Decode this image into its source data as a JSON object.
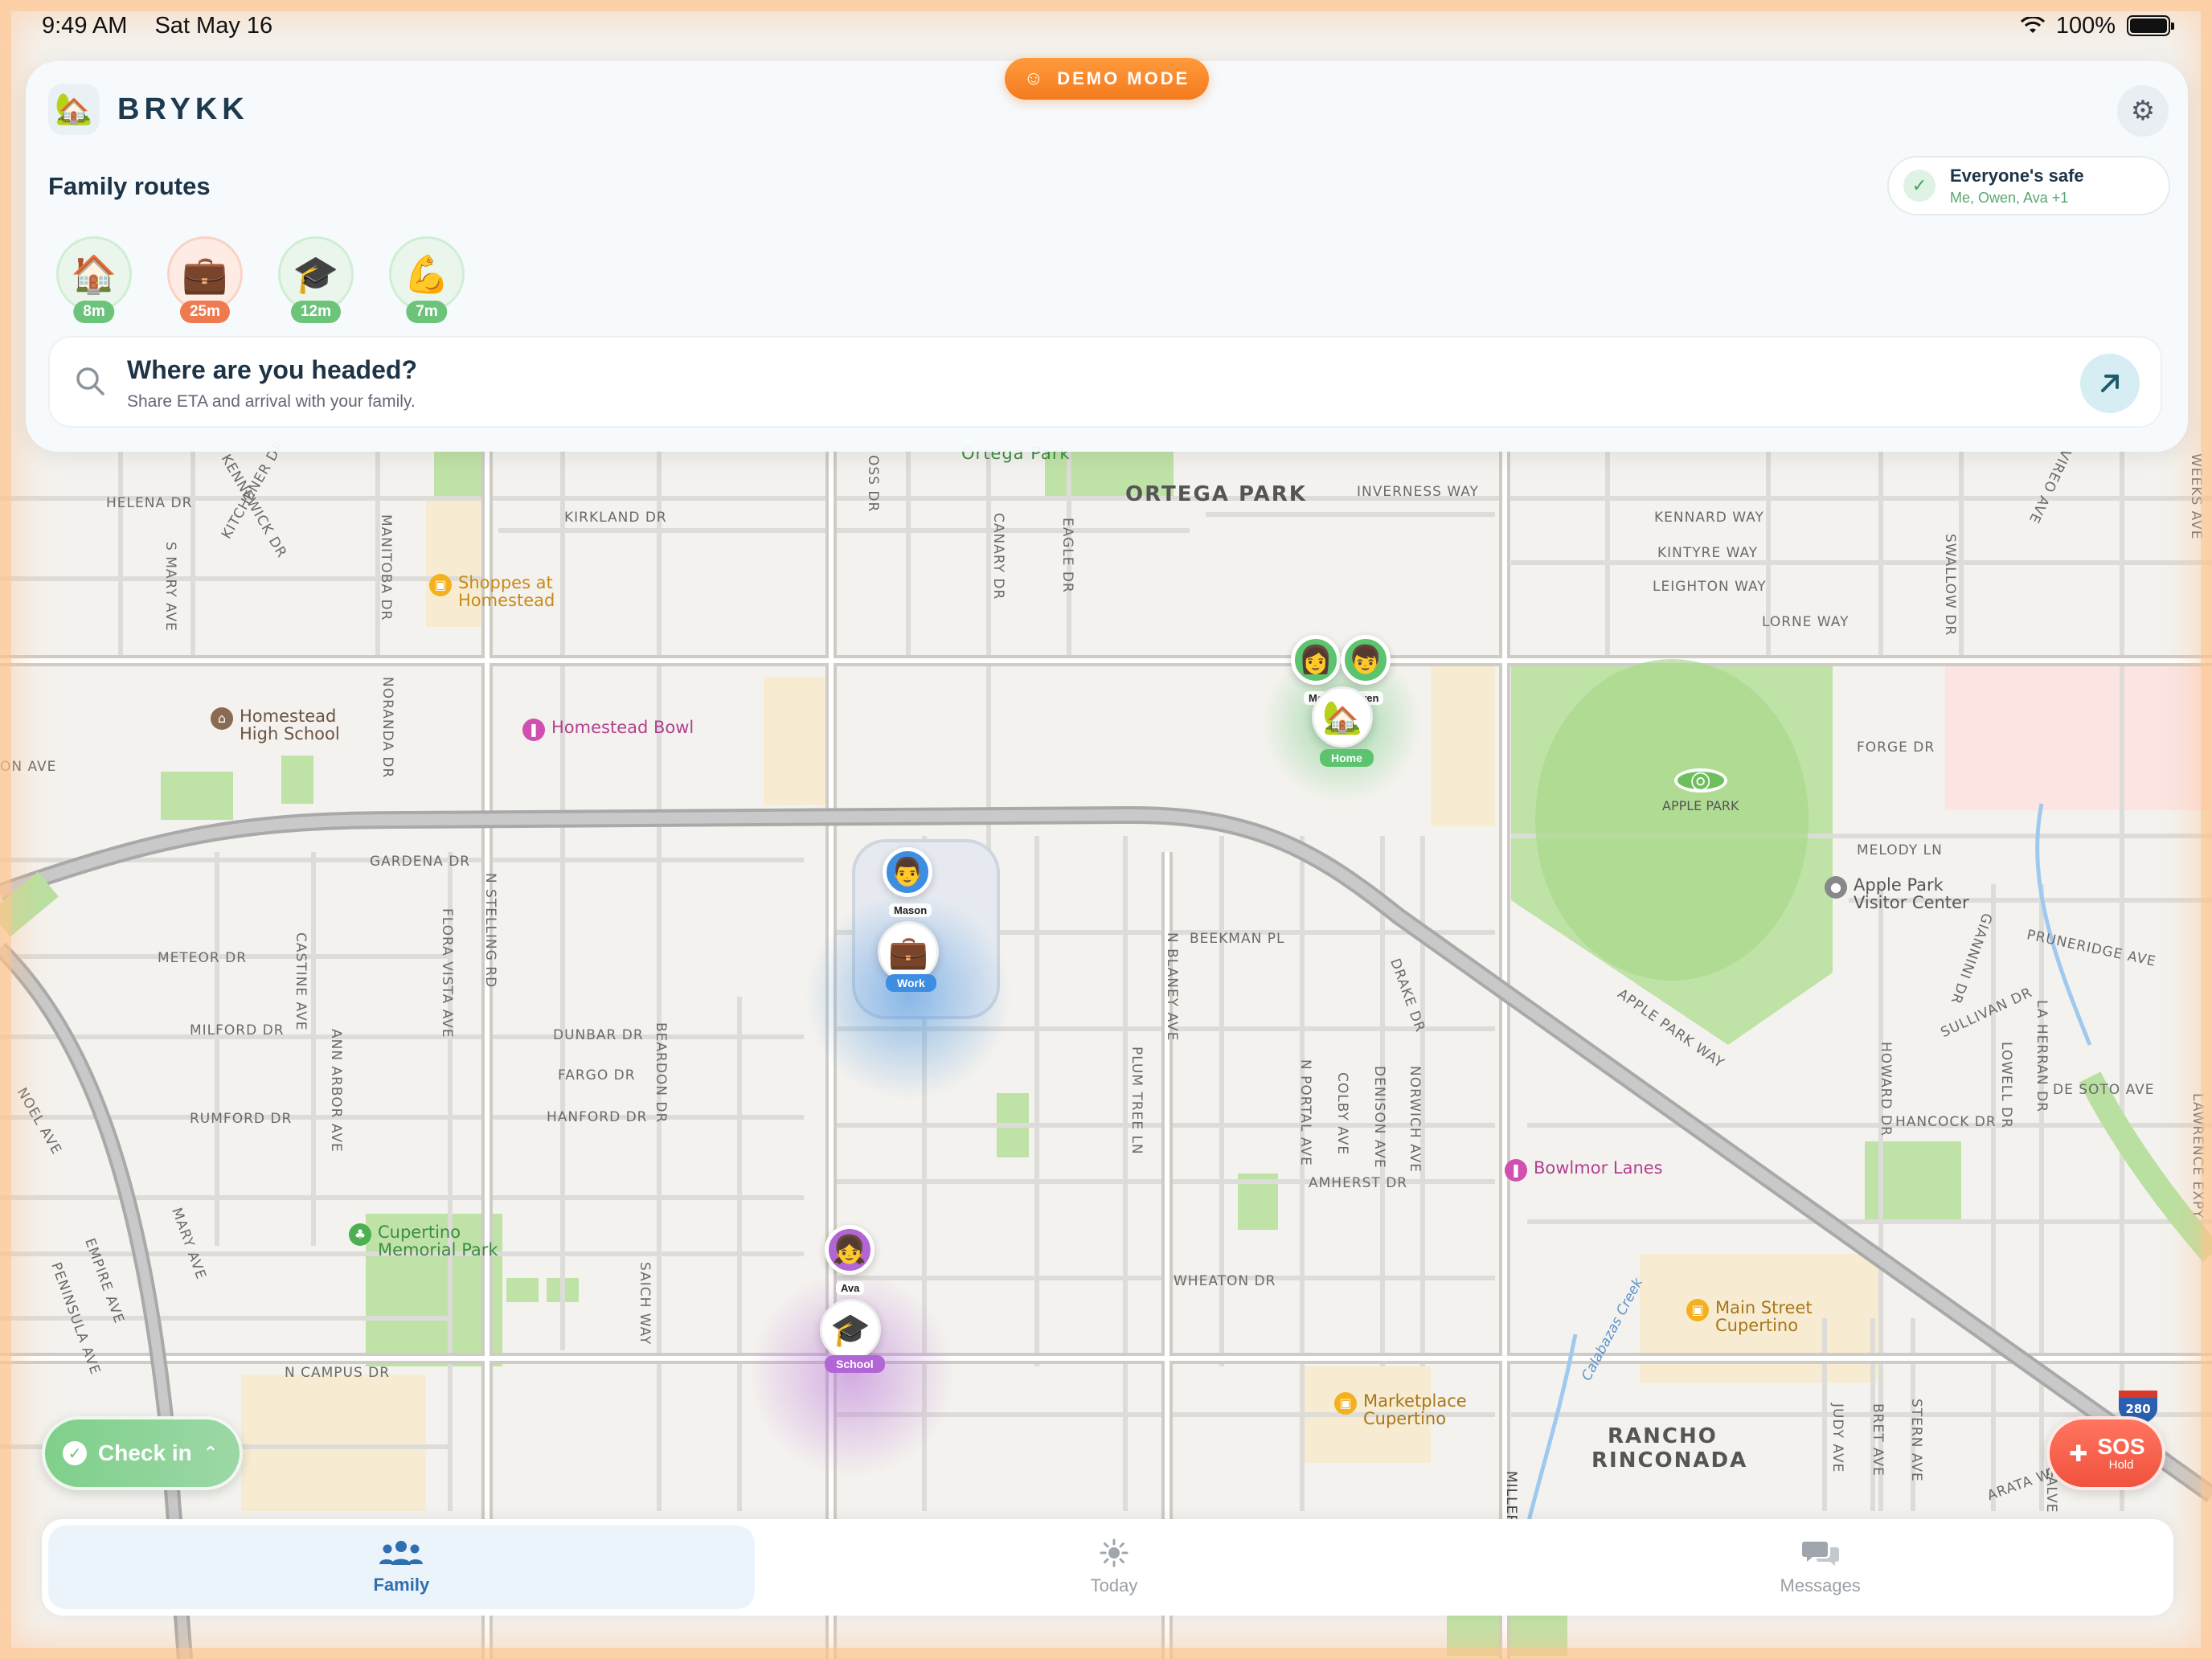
{
  "status_bar": {
    "time": "9:49 AM",
    "date": "Sat May 16",
    "battery": "100%",
    "battery_level": 1.0
  },
  "demo_badge": {
    "label": "DEMO MODE",
    "icon": "theater-masks-icon"
  },
  "app": {
    "name": "BRYKK",
    "logo_icon": "house-tree-icon"
  },
  "section_title": "Family routes",
  "safety": {
    "title": "Everyone's safe",
    "members": "Me, Owen, Ava +1"
  },
  "routes": [
    {
      "icon": "🏠",
      "eta": "8m",
      "color": "#6cc47a",
      "bg": "#eaf6ec"
    },
    {
      "icon": "💼",
      "eta": "25m",
      "color": "#f07a50",
      "bg": "#fdebe4"
    },
    {
      "icon": "🎓",
      "eta": "12m",
      "color": "#6cc47a",
      "bg": "#eaf6ec"
    },
    {
      "icon": "💪",
      "eta": "7m",
      "color": "#6cc47a",
      "bg": "#eaf6ec"
    }
  ],
  "search": {
    "title": "Where are you headed?",
    "subtitle": "Share ETA and arrival with your family."
  },
  "map": {
    "areas": [
      "ORTEGA PARK",
      "RANCHO",
      "RINCONADA"
    ],
    "parks": [
      "Ortega Park"
    ],
    "streets_h": [
      "HELENA DR",
      "KIRKLAND DR",
      "INVERNESS WAY",
      "KENNARD WAY",
      "KINTYRE WAY",
      "LEIGHTON WAY",
      "LORNE WAY",
      "FORGE DR",
      "MELODY LN",
      "GARDENA DR",
      "BEEKMAN PL",
      "METEOR DR",
      "PRUNERIDGE AVE",
      "MILFORD DR",
      "DUNBAR DR",
      "FARGO DR",
      "HANFORD DR",
      "RUMFORD DR",
      "HANCOCK DR",
      "DE SOTO AVE",
      "AMHERST DR",
      "WHEATON DR",
      "N CAMPUS DR",
      "ON AVE",
      "SULLIVAN DR",
      "APPLE PARK WAY",
      "ARATA WAY"
    ],
    "streets_v": [
      "S MARY AVE",
      "KITCHENER DR",
      "KENNEWICK DR",
      "MANITOBA DR",
      "NORANDA DR",
      "N STELLING RD",
      "FLORA VISTA AVE",
      "CASTINE AVE",
      "ANN ARBOR AVE",
      "BEARDON DR",
      "OSS DR",
      "CANARY DR",
      "EAGLE DR",
      "N BLANEY AVE",
      "PLUM TREE LN",
      "N PORTAL AVE",
      "COLBY AVE",
      "DENISON AVE",
      "NORWICH AVE",
      "DRAKE DR",
      "HOWARD DR",
      "LOWELL DR",
      "LA HERRAN DR",
      "GIANNINI DR",
      "SWALLOW DR",
      "WEEKS AVE",
      "VIREO AVE",
      "SAICH WAY",
      "MARY AVE",
      "EMPIRE AVE",
      "PENINSULA AVE",
      "NOEL AVE",
      "JUDY AVE",
      "BRET AVE",
      "STERN AVE",
      "MILLER",
      "LAWRENCE EXPY",
      "CALVE",
      "Calabazas Creek"
    ],
    "pois": [
      {
        "name": "Shoppes at\nHomestead",
        "icon": "shopping-bag-icon",
        "color": "#f5b01f",
        "text_color": "#c98a12"
      },
      {
        "name": "Homestead\nHigh School",
        "icon": "school-icon",
        "color": "#8a6a52",
        "text_color": "#6b5341"
      },
      {
        "name": "Homestead Bowl",
        "icon": "bowling-icon",
        "color": "#d04fb0",
        "text_color": "#b2408f"
      },
      {
        "name": "APPLE PARK",
        "icon": "apple-park-icon",
        "color": "#6cbf5a",
        "text_color": "#555"
      },
      {
        "name": "Apple Park\nVisitor Center",
        "icon": "apple-icon",
        "color": "#888",
        "text_color": "#555"
      },
      {
        "name": "Bowlmor Lanes",
        "icon": "bowling-icon",
        "color": "#d04fb0",
        "text_color": "#b2408f"
      },
      {
        "name": "Cupertino\nMemorial Park",
        "icon": "tree-icon",
        "color": "#4caf50",
        "text_color": "#3d8d42"
      },
      {
        "name": "Main Street\nCupertino",
        "icon": "shopping-bag-icon",
        "color": "#f5b01f",
        "text_color": "#a8761a"
      },
      {
        "name": "Marketplace\nCupertino",
        "icon": "shopping-bag-icon",
        "color": "#f5b01f",
        "text_color": "#a8761a"
      }
    ],
    "highway_shield": "280"
  },
  "people": [
    {
      "name": "Me",
      "emoji": "👩",
      "ring": "#5cc46e"
    },
    {
      "name": "Owen",
      "emoji": "👦",
      "ring": "#5cc46e"
    },
    {
      "name": "Mason",
      "emoji": "👨",
      "ring": "#3d8ee0"
    },
    {
      "name": "Ava",
      "emoji": "👧",
      "ring": "#b266d6"
    }
  ],
  "places": [
    {
      "label": "Home",
      "emoji": "🏡",
      "color": "#5cc46e"
    },
    {
      "label": "Work",
      "emoji": "💼",
      "color": "#3d8ee0"
    },
    {
      "label": "School",
      "emoji": "🎓",
      "color": "#b266d6"
    }
  ],
  "checkin": {
    "label": "Check in"
  },
  "sos": {
    "label": "SOS",
    "sub": "Hold"
  },
  "tabs": [
    {
      "label": "Family",
      "icon": "people-icon",
      "active": true
    },
    {
      "label": "Today",
      "icon": "sun-icon",
      "active": false
    },
    {
      "label": "Messages",
      "icon": "chat-bubbles-icon",
      "active": false
    }
  ]
}
